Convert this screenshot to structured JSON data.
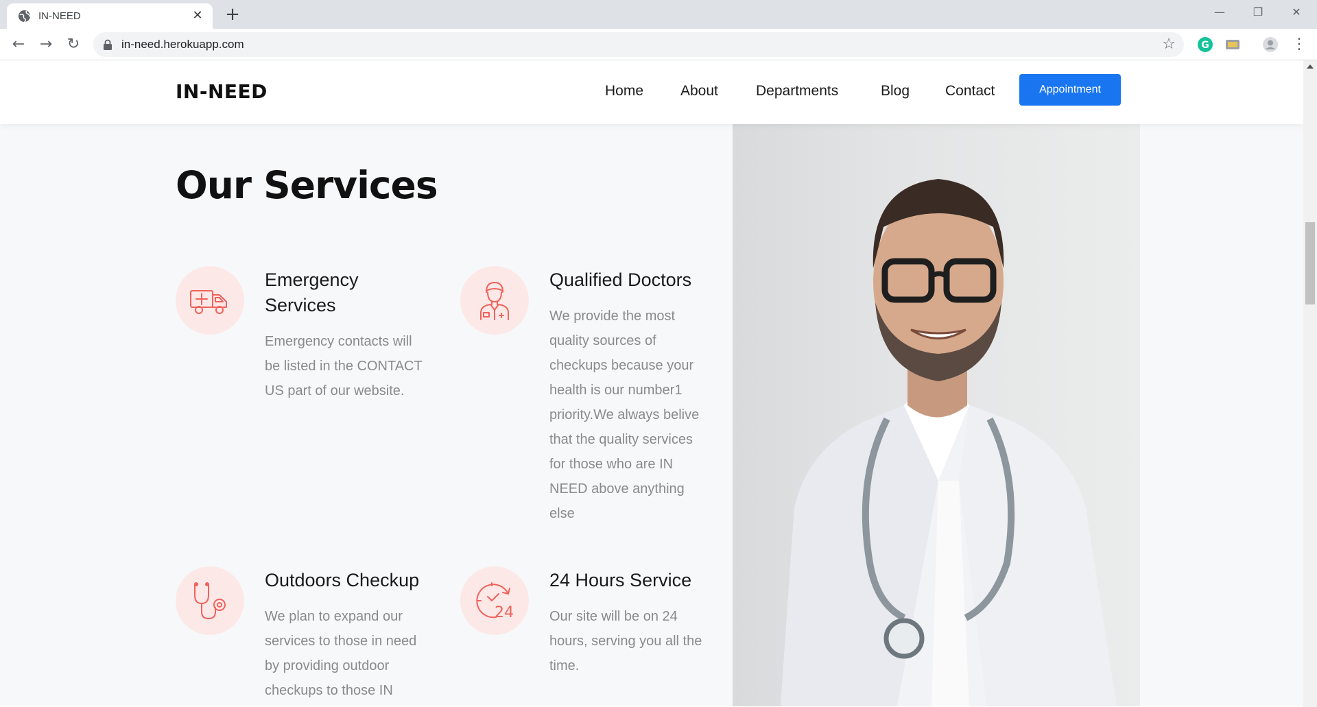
{
  "browser": {
    "tab_title": "IN-NEED",
    "url": "in-need.herokuapp.com"
  },
  "site": {
    "logo": "IN-NEED",
    "nav": [
      {
        "label": "Home"
      },
      {
        "label": "About"
      },
      {
        "label": "Departments"
      },
      {
        "label": "Blog"
      },
      {
        "label": "Contact"
      }
    ],
    "appointment_label": "Appointment"
  },
  "services": {
    "title": "Our Services",
    "items": [
      {
        "icon": "ambulance-icon",
        "title_lines": [
          "Emergency",
          "Services"
        ],
        "text_lines": [
          "Emergency contacts will",
          "be listed in the CONTACT",
          "US part of our website."
        ]
      },
      {
        "icon": "doctor-icon",
        "title_lines": [
          "Qualified Doctors"
        ],
        "text_lines": [
          "We provide the most",
          "quality sources of",
          "checkups because your",
          "health is our number1",
          "priority.We always belive",
          "that the quality services",
          "for those who are IN",
          "NEED above anything",
          "else"
        ]
      },
      {
        "icon": "stethoscope-icon",
        "title_lines": [
          "Outdoors Checkup"
        ],
        "text_lines": [
          "We plan to expand our",
          "services to those in need",
          "by providing outdoor",
          "checkups to those IN"
        ]
      },
      {
        "icon": "clock-24-icon",
        "title_lines": [
          "24 Hours Service"
        ],
        "text_lines": [
          "Our site will be on 24",
          "hours, serving you all the",
          "time."
        ]
      }
    ]
  },
  "colors": {
    "accent": "#1a76f0",
    "icon_bg": "#fde8e8",
    "icon_stroke": "#f0625a"
  }
}
